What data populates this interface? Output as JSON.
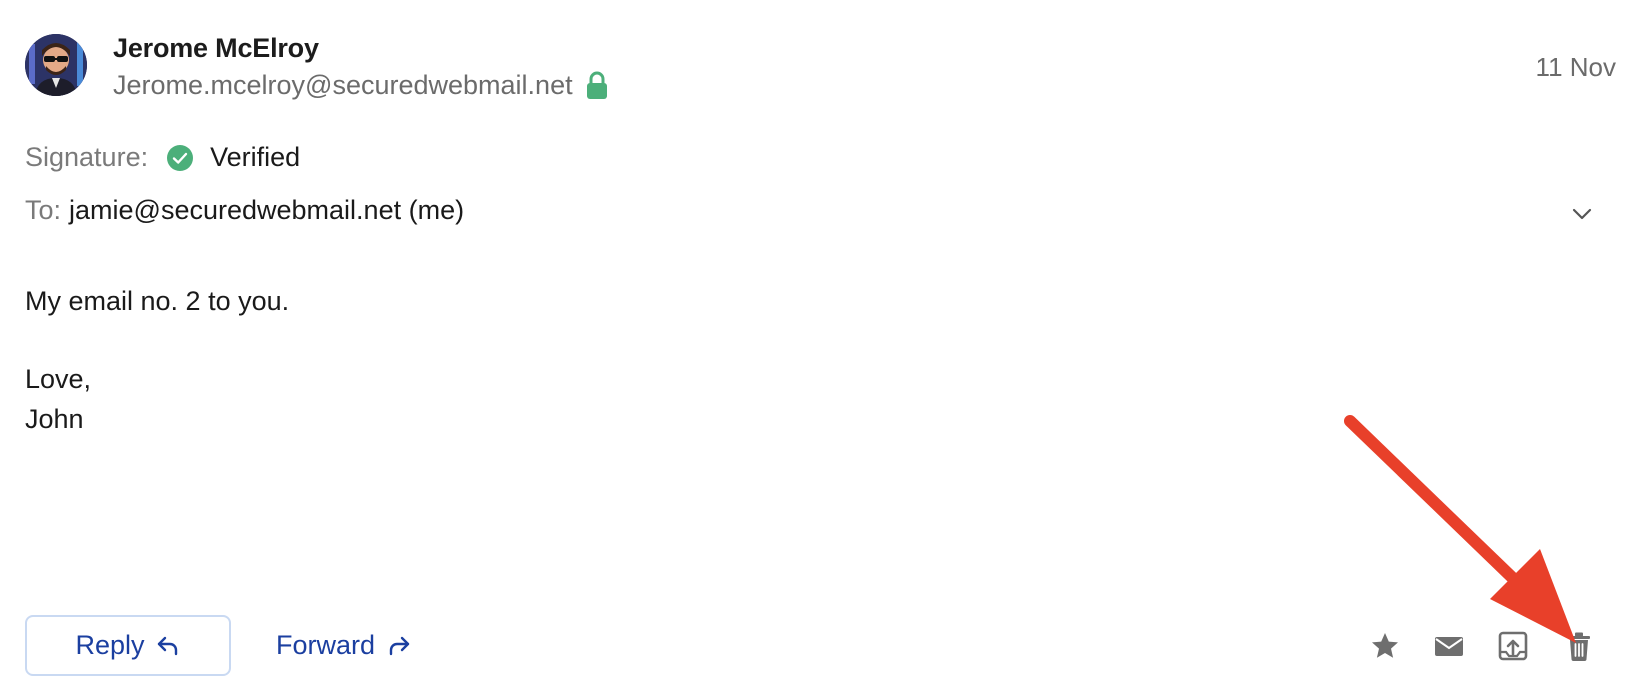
{
  "sender": {
    "name": "Jerome McElroy",
    "email": "Jerome.mcelroy@securedwebmail.net",
    "secure_icon": "lock-icon",
    "avatar_icon": "avatar"
  },
  "date": "11 Nov",
  "signature": {
    "label": "Signature:",
    "status": "Verified",
    "status_icon": "check-circle-icon",
    "status_color": "#4caf7a"
  },
  "recipients": {
    "label": "To:",
    "value": "jamie@securedwebmail.net (me)"
  },
  "body": {
    "line1": "My email no. 2 to you.",
    "line2": "Love,",
    "line3": "John"
  },
  "actions": {
    "reply_label": "Reply",
    "forward_label": "Forward",
    "icons": [
      "star-icon",
      "mail-icon",
      "move-to-folder-icon",
      "trash-icon"
    ]
  },
  "colors": {
    "accent": "#1b3fa0",
    "secure_green": "#4caf7a",
    "annotation_arrow": "#e8402a"
  }
}
